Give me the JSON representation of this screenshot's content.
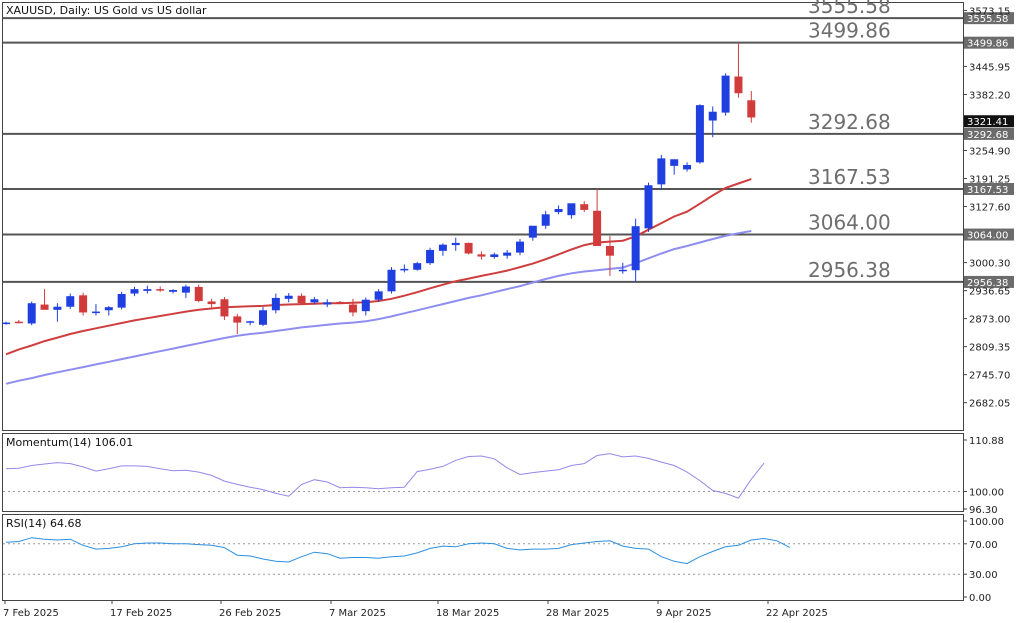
{
  "chart_data": [
    {
      "type": "candlestick",
      "title": "XAUUSD, Daily:  US Gold vs US dollar",
      "symbol": "XAUUSD",
      "yticks": [
        "3573.15",
        "3555.58",
        "3499.86",
        "3445.95",
        "3382.20",
        "3321.41",
        "3292.68",
        "3254.90",
        "3191.25",
        "3167.53",
        "3127.60",
        "3064.00",
        "3000.30",
        "2956.38",
        "2936.65",
        "2873.00",
        "2809.35",
        "2745.70",
        "2682.05"
      ],
      "ylim": [
        2620,
        3590
      ],
      "current_price": "3321.41",
      "xticks": [
        "7 Feb 2025",
        "17 Feb 2025",
        "26 Feb 2025",
        "7 Mar 2025",
        "18 Mar 2025",
        "28 Mar 2025",
        "9 Apr 2025",
        "22 Apr 2025"
      ],
      "levels": [
        {
          "value": 3555.58,
          "label": "3555.58"
        },
        {
          "value": 3499.86,
          "label": "3499.86"
        },
        {
          "value": 3292.68,
          "label": "3292.68"
        },
        {
          "value": 3167.53,
          "label": "3167.53"
        },
        {
          "value": 3064.0,
          "label": "3064.00"
        },
        {
          "value": 2956.38,
          "label": "2956.38"
        }
      ],
      "candles": [
        {
          "o": 2862,
          "h": 2866,
          "l": 2859,
          "c": 2864
        },
        {
          "o": 2866,
          "h": 2870,
          "l": 2862,
          "c": 2865
        },
        {
          "o": 2862,
          "h": 2912,
          "l": 2858,
          "c": 2908
        },
        {
          "o": 2905,
          "h": 2940,
          "l": 2896,
          "c": 2893
        },
        {
          "o": 2893,
          "h": 2908,
          "l": 2866,
          "c": 2900
        },
        {
          "o": 2900,
          "h": 2930,
          "l": 2895,
          "c": 2924
        },
        {
          "o": 2926,
          "h": 2932,
          "l": 2880,
          "c": 2887
        },
        {
          "o": 2887,
          "h": 2906,
          "l": 2880,
          "c": 2889
        },
        {
          "o": 2892,
          "h": 2902,
          "l": 2880,
          "c": 2899
        },
        {
          "o": 2898,
          "h": 2934,
          "l": 2894,
          "c": 2929
        },
        {
          "o": 2930,
          "h": 2945,
          "l": 2924,
          "c": 2940
        },
        {
          "o": 2936,
          "h": 2948,
          "l": 2930,
          "c": 2940
        },
        {
          "o": 2940,
          "h": 2946,
          "l": 2934,
          "c": 2937
        },
        {
          "o": 2934,
          "h": 2940,
          "l": 2930,
          "c": 2938
        },
        {
          "o": 2932,
          "h": 2950,
          "l": 2920,
          "c": 2946
        },
        {
          "o": 2945,
          "h": 2950,
          "l": 2910,
          "c": 2913
        },
        {
          "o": 2912,
          "h": 2918,
          "l": 2895,
          "c": 2906
        },
        {
          "o": 2917,
          "h": 2922,
          "l": 2870,
          "c": 2878
        },
        {
          "o": 2878,
          "h": 2884,
          "l": 2838,
          "c": 2864
        },
        {
          "o": 2864,
          "h": 2868,
          "l": 2858,
          "c": 2867
        },
        {
          "o": 2859,
          "h": 2899,
          "l": 2856,
          "c": 2892
        },
        {
          "o": 2892,
          "h": 2930,
          "l": 2885,
          "c": 2920
        },
        {
          "o": 2918,
          "h": 2931,
          "l": 2910,
          "c": 2925
        },
        {
          "o": 2925,
          "h": 2930,
          "l": 2904,
          "c": 2908
        },
        {
          "o": 2910,
          "h": 2922,
          "l": 2905,
          "c": 2917
        },
        {
          "o": 2905,
          "h": 2917,
          "l": 2899,
          "c": 2910
        },
        {
          "o": 2911,
          "h": 2913,
          "l": 2908,
          "c": 2909
        },
        {
          "o": 2905,
          "h": 2918,
          "l": 2878,
          "c": 2887
        },
        {
          "o": 2890,
          "h": 2921,
          "l": 2880,
          "c": 2916
        },
        {
          "o": 2916,
          "h": 2940,
          "l": 2911,
          "c": 2935
        },
        {
          "o": 2935,
          "h": 2990,
          "l": 2930,
          "c": 2984
        },
        {
          "o": 2984,
          "h": 2996,
          "l": 2978,
          "c": 2986
        },
        {
          "o": 2984,
          "h": 3002,
          "l": 2982,
          "c": 2999
        },
        {
          "o": 2999,
          "h": 3034,
          "l": 2995,
          "c": 3029
        },
        {
          "o": 3027,
          "h": 3044,
          "l": 3016,
          "c": 3041
        },
        {
          "o": 3040,
          "h": 3057,
          "l": 3027,
          "c": 3045
        },
        {
          "o": 3045,
          "h": 3046,
          "l": 3019,
          "c": 3021
        },
        {
          "o": 3019,
          "h": 3026,
          "l": 3007,
          "c": 3014
        },
        {
          "o": 3013,
          "h": 3023,
          "l": 3009,
          "c": 3019
        },
        {
          "o": 3016,
          "h": 3029,
          "l": 3009,
          "c": 3023
        },
        {
          "o": 3023,
          "h": 3054,
          "l": 3017,
          "c": 3048
        },
        {
          "o": 3057,
          "h": 3080,
          "l": 3050,
          "c": 3084
        },
        {
          "o": 3084,
          "h": 3118,
          "l": 3077,
          "c": 3110
        },
        {
          "o": 3115,
          "h": 3130,
          "l": 3110,
          "c": 3122
        },
        {
          "o": 3108,
          "h": 3134,
          "l": 3100,
          "c": 3135
        },
        {
          "o": 3133,
          "h": 3140,
          "l": 3115,
          "c": 3120
        },
        {
          "o": 3118,
          "h": 3167,
          "l": 3050,
          "c": 3038
        },
        {
          "o": 3038,
          "h": 3061,
          "l": 2970,
          "c": 3016
        },
        {
          "o": 2984,
          "h": 3000,
          "l": 2975,
          "c": 2984
        },
        {
          "o": 2983,
          "h": 3100,
          "l": 2956,
          "c": 3083
        },
        {
          "o": 3078,
          "h": 3182,
          "l": 3070,
          "c": 3176
        },
        {
          "o": 3178,
          "h": 3245,
          "l": 3165,
          "c": 3237
        },
        {
          "o": 3220,
          "h": 3235,
          "l": 3200,
          "c": 3235
        },
        {
          "o": 3212,
          "h": 3228,
          "l": 3207,
          "c": 3222
        },
        {
          "o": 3228,
          "h": 3360,
          "l": 3225,
          "c": 3358
        },
        {
          "o": 3323,
          "h": 3355,
          "l": 3285,
          "c": 3343
        },
        {
          "o": 3341,
          "h": 3430,
          "l": 3334,
          "c": 3425
        },
        {
          "o": 3423,
          "h": 3500,
          "l": 3375,
          "c": 3385
        },
        {
          "o": 3369,
          "h": 3390,
          "l": 3318,
          "c": 3330
        }
      ],
      "ma_fast": [
        2792,
        2803,
        2812,
        2822,
        2830,
        2838,
        2845,
        2851,
        2857,
        2863,
        2869,
        2874,
        2879,
        2884,
        2889,
        2893,
        2896,
        2899,
        2900,
        2901,
        2902,
        2904,
        2905,
        2906,
        2907,
        2908,
        2908,
        2909,
        2910,
        2913,
        2918,
        2925,
        2933,
        2942,
        2950,
        2958,
        2964,
        2970,
        2976,
        2982,
        2990,
        2998,
        3008,
        3019,
        3030,
        3040,
        3046,
        3048,
        3050,
        3060,
        3075,
        3090,
        3105,
        3116,
        3134,
        3153,
        3170,
        3180,
        3190
      ],
      "ma_slow": [
        2725,
        2732,
        2738,
        2745,
        2751,
        2757,
        2763,
        2769,
        2775,
        2781,
        2787,
        2793,
        2799,
        2805,
        2811,
        2817,
        2823,
        2829,
        2834,
        2838,
        2841,
        2845,
        2849,
        2853,
        2856,
        2859,
        2862,
        2864,
        2867,
        2872,
        2878,
        2885,
        2892,
        2899,
        2906,
        2913,
        2920,
        2926,
        2933,
        2940,
        2947,
        2955,
        2963,
        2970,
        2976,
        2980,
        2983,
        2986,
        2989,
        2999,
        3010,
        3021,
        3031,
        3038,
        3046,
        3054,
        3061,
        3067,
        3072
      ]
    },
    {
      "type": "line",
      "title": "Momentum(14) 106.01",
      "yticks": [
        "110.88",
        "100.00",
        "96.30"
      ],
      "ylim": [
        96.3,
        110.88
      ],
      "refline": 100,
      "values": [
        104.8,
        104.9,
        105.5,
        105.8,
        106.1,
        105.9,
        105.2,
        104.3,
        104.8,
        105.4,
        105.4,
        105.3,
        104.8,
        104.4,
        104.5,
        104.1,
        103.4,
        102.2,
        101.5,
        100.9,
        100.4,
        99.6,
        99.0,
        101.5,
        102.5,
        102.0,
        100.8,
        100.9,
        100.8,
        100.6,
        100.8,
        100.9,
        104.2,
        104.7,
        105.3,
        106.6,
        107.4,
        107.5,
        106.9,
        105.0,
        103.6,
        104.0,
        104.3,
        104.6,
        105.5,
        105.9,
        107.6,
        108.0,
        107.3,
        107.5,
        107.0,
        106.2,
        105.5,
        104.1,
        102.3,
        100.2,
        99.6,
        98.6,
        102.6,
        106.0
      ]
    },
    {
      "type": "line",
      "title": "RSI(14) 64.68",
      "yticks": [
        "100.00",
        "70.00",
        "30.00",
        "0.00"
      ],
      "ylim": [
        0,
        100
      ],
      "levels": [
        70,
        30
      ],
      "values": [
        72,
        73,
        78,
        76,
        75,
        76,
        68,
        63,
        64,
        66,
        70,
        71,
        71,
        70,
        70,
        69,
        68,
        65,
        55,
        54,
        50,
        47,
        46,
        53,
        59,
        57,
        51,
        52,
        52,
        51,
        53,
        54,
        58,
        64,
        67,
        66,
        70,
        71,
        70,
        64,
        62,
        63,
        63,
        64,
        69,
        71,
        73,
        74,
        67,
        64,
        63,
        53,
        47,
        44,
        53,
        60,
        66,
        68,
        75,
        77,
        74,
        65
      ]
    }
  ]
}
